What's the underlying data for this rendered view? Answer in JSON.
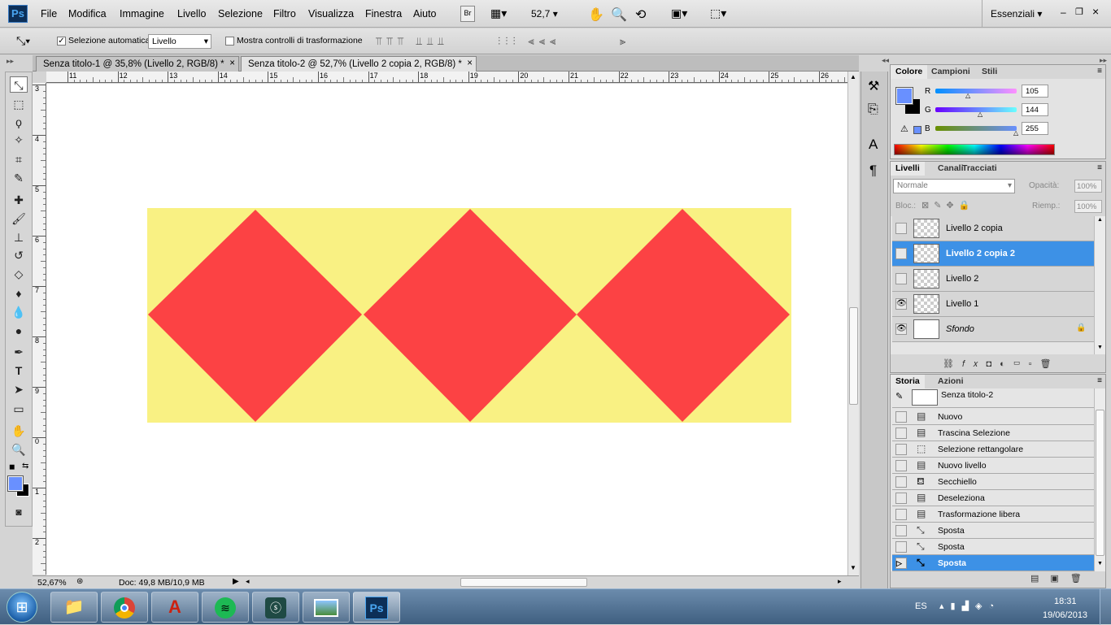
{
  "app": {
    "logo": "Ps",
    "zoom_box": "52,7",
    "workspace": "Essenziali",
    "br_label": "Br"
  },
  "menu": [
    "File",
    "Modifica",
    "Immagine",
    "Livello",
    "Selezione",
    "Filtro",
    "Visualizza",
    "Finestra",
    "Aiuto"
  ],
  "options": {
    "auto_select_label": "Selezione automatica:",
    "auto_select_checked": "✓",
    "auto_select_value": "Livello",
    "transform_label": "Mostra controlli di trasformazione"
  },
  "tabs": [
    {
      "label": "Senza titolo-1 @ 35,8% (Livello 2, RGB/8) *",
      "close": "×"
    },
    {
      "label": "Senza titolo-2 @ 52,7% (Livello 2 copia 2, RGB/8) *",
      "close": "×"
    }
  ],
  "ruler_h": [
    "11",
    "12",
    "13",
    "14",
    "15",
    "16",
    "17",
    "18",
    "19",
    "20",
    "21",
    "22",
    "23",
    "24",
    "25",
    "26"
  ],
  "ruler_v": [
    "3",
    "4",
    "5",
    "6",
    "7",
    "8",
    "9",
    "0",
    "1",
    "2"
  ],
  "status": {
    "zoom": "52,67%",
    "doc": "Doc: 49,8 MB/10,9 MB"
  },
  "color_panel": {
    "tabs": [
      "Colore",
      "Campioni",
      "Stili"
    ],
    "r_label": "R",
    "g_label": "G",
    "b_label": "B",
    "r": "105",
    "g": "144",
    "b": "255",
    "fg": "#6990ff"
  },
  "layers_panel": {
    "tabs": [
      "Livelli",
      "Canali",
      "Tracciati"
    ],
    "blend": "Normale",
    "opacity_label": "Opacità:",
    "opacity": "100%",
    "lock_label": "Bloc.:",
    "fill_label": "Riemp.:",
    "fill": "100%",
    "layers": [
      {
        "name": "Livello 2 copia",
        "visible": false,
        "selected": false
      },
      {
        "name": "Livello 2 copia 2",
        "visible": false,
        "selected": true
      },
      {
        "name": "Livello 2",
        "visible": false,
        "selected": false
      },
      {
        "name": "Livello 1",
        "visible": true,
        "selected": false
      },
      {
        "name": "Sfondo",
        "visible": true,
        "selected": false
      }
    ]
  },
  "history_panel": {
    "tabs": [
      "Storia",
      "Azioni"
    ],
    "snapshot": "Senza titolo-2",
    "items": [
      "Nuovo",
      "Trascina Selezione",
      "Selezione rettangolare",
      "Nuovo livello",
      "Secchiello",
      "Deseleziona",
      "Trasformazione libera",
      "Sposta",
      "Sposta",
      "Sposta"
    ]
  },
  "artwork": {
    "bg": "#f9f183",
    "diamond": "#fc4244"
  },
  "taskbar": {
    "lang": "ES",
    "time": "18:31",
    "date": "19/06/2013"
  }
}
